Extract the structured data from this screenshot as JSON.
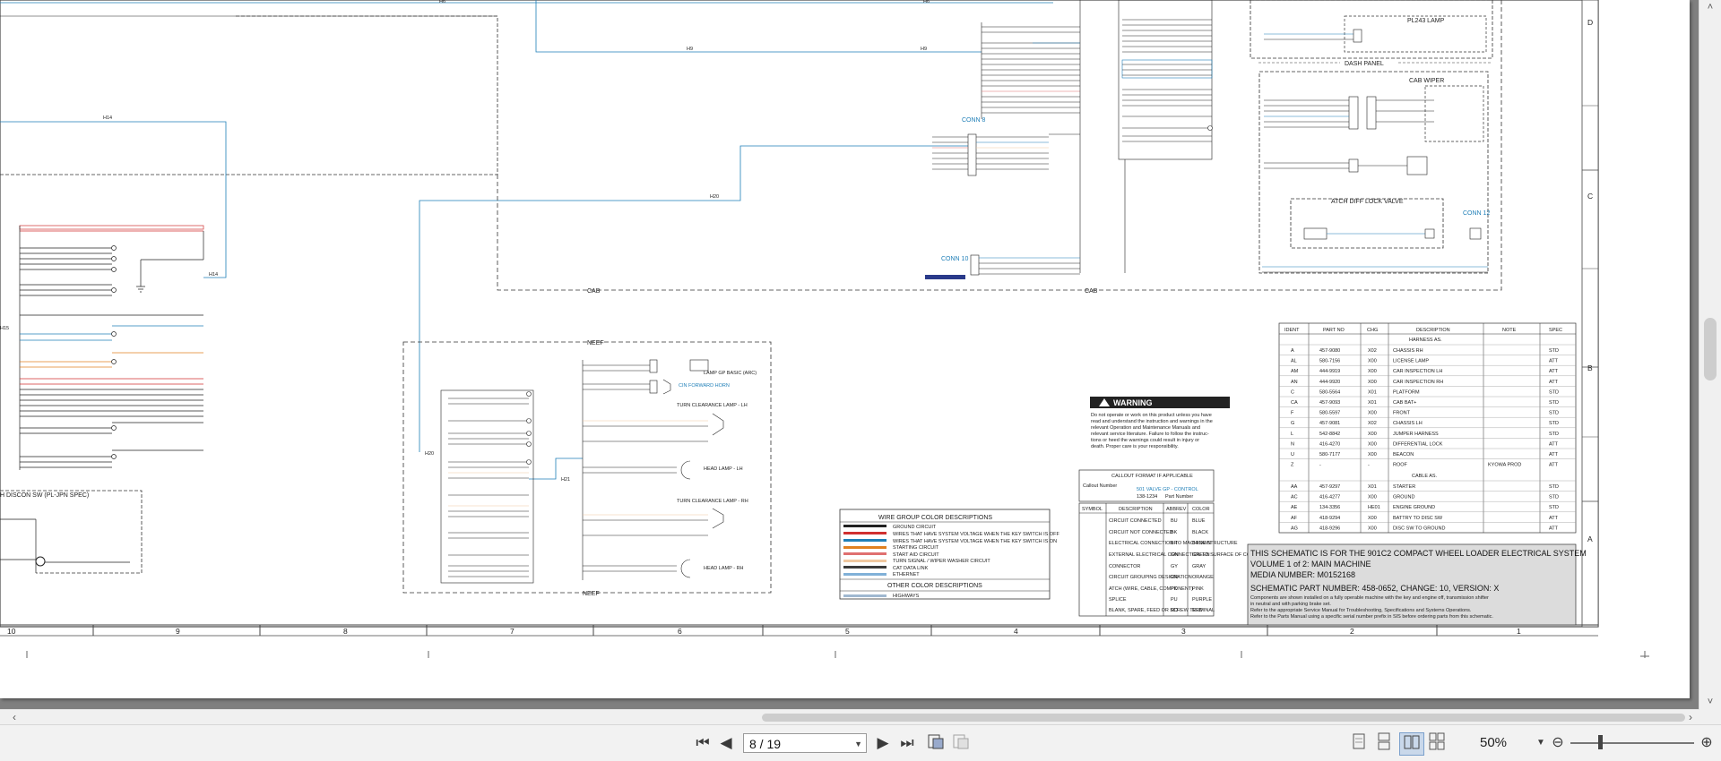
{
  "toolbar": {
    "first_page": "⏮",
    "prev_page": "◀",
    "page_field": "8 / 19",
    "next_page": "▶",
    "last_page": "⏭",
    "zoom": "50%"
  },
  "schematic": {
    "title_block": {
      "line1": "THIS SCHEMATIC IS FOR THE  901C2 COMPACT WHEEL LOADER ELECTRICAL SYSTEM",
      "line2": "VOLUME 1 of 2: MAIN MACHINE",
      "line3": "MEDIA NUMBER: M0152168",
      "line4": "SCHEMATIC PART NUMBER: 458-0652, CHANGE: 10, VERSION: X",
      "note1": "Components are shown installed on a fully operable machine with the key and engine off, transmission shifter",
      "note2": "in neutral and with parking brake set.",
      "note3": "Refer to the appropriate Service Manual for Troubleshooting, Specifications and Systems Operations.",
      "note4": "Refer to the Parts Manual using a specific serial number prefix in SIS before ordering parts from this schematic."
    },
    "warning": {
      "title": "WARNING",
      "text": [
        "Do not operate or work on this product unless you have",
        "read and understand the instruction and warnings in the",
        "relevant Operation and Maintenance Manuals and",
        "relevant service literature. Failure to follow the instruc-",
        "tions or heed the warnings could result in injury or",
        "death. Proper care is your responsibility."
      ]
    },
    "harness_table": {
      "headers": [
        "IDENT",
        "PART NO",
        "CHG",
        "DESCRIPTION",
        "NOTE",
        "SPEC"
      ],
      "section1": "HARNESS AS.",
      "rows1": [
        [
          "A",
          "457-9080",
          "X02",
          "CHASSIS RH",
          "",
          "STD"
        ],
        [
          "AL",
          "580-7156",
          "X00",
          "LICENSE LAMP",
          "",
          "ATT"
        ],
        [
          "AM",
          "444-9919",
          "X00",
          "CAR INSPECTION LH",
          "",
          "ATT"
        ],
        [
          "AN",
          "444-9920",
          "X00",
          "CAR INSPECTION RH",
          "",
          "ATT"
        ],
        [
          "C",
          "580-5564",
          "X01",
          "PLATFORM",
          "",
          "STD"
        ],
        [
          "CA",
          "457-9093",
          "X01",
          "CAB BAT+",
          "",
          "STD"
        ],
        [
          "F",
          "580-5597",
          "X00",
          "FRONT",
          "",
          "STD"
        ],
        [
          "G",
          "457-9081",
          "X02",
          "CHASSIS LH",
          "",
          "STD"
        ],
        [
          "L",
          "542-8842",
          "X00",
          "JUMPER HARNESS",
          "",
          "STD"
        ],
        [
          "N",
          "416-4270",
          "X00",
          "DIFFERENTIAL LOCK",
          "",
          "ATT"
        ],
        [
          "U",
          "580-7177",
          "X00",
          "BEACON",
          "",
          "ATT"
        ],
        [
          "Z",
          "-",
          "-",
          "ROOF",
          "KYOWA PROD",
          "ATT"
        ]
      ],
      "section2": "CABLE AS.",
      "rows2": [
        [
          "AA",
          "457-9297",
          "X01",
          "STARTER",
          "",
          "STD"
        ],
        [
          "AC",
          "416-4277",
          "X00",
          "GROUND",
          "",
          "STD"
        ],
        [
          "AE",
          "134-3356",
          "HE01",
          "ENGINE GROUND",
          "",
          "STD"
        ],
        [
          "AF",
          "418-9294",
          "X00",
          "BATTRY TO DISC SW",
          "",
          "ATT"
        ],
        [
          "AG",
          "418-9296",
          "X00",
          "DISC SW TO GROUND",
          "",
          "ATT"
        ]
      ]
    },
    "wire_colors": {
      "title": "WIRE GROUP COLOR DESCRIPTIONS",
      "items": [
        {
          "label": "GROUND CIRCUIT",
          "color": "#222222"
        },
        {
          "label": "WIRES THAT HAVE SYSTEM VOLTAGE WHEN THE KEY SWITCH IS OFF",
          "color": "#d03030"
        },
        {
          "label": "WIRES THAT HAVE SYSTEM VOLTAGE WHEN THE KEY SWITCH IS ON",
          "color": "#1f7fb8"
        },
        {
          "label": "STARTING CIRCUIT",
          "color": "#e08020"
        },
        {
          "label": "START AID CIRCUIT",
          "color": "#e07070"
        },
        {
          "label": "TURN SIGNAL / WIPER WASHER CIRCUIT",
          "color": "#f0c8a0"
        },
        {
          "label": "CAT DATA LINK",
          "color": "#3a3a3a"
        },
        {
          "label": "ETHERNET",
          "color": "#80b0d8"
        }
      ],
      "other_title": "OTHER COLOR DESCRIPTIONS",
      "other_items": [
        {
          "label": "HIGHWAYS",
          "color": "#a0b8d0"
        }
      ]
    },
    "callout": {
      "title": "CALLOUT FORMAT IF APPLICABLE",
      "callout_number": "Callout Number",
      "component_label": "501 VALVE GP - CONTROL",
      "part_number": "138-1234",
      "part_label": "Part Number",
      "headers": [
        "SYMBOL",
        "DESCRIPTION",
        "ABBREV",
        "COLOR"
      ],
      "rows": [
        [
          "CIRCUIT CONNECTED",
          "BU",
          "BLUE"
        ],
        [
          "CIRCUIT NOT CONNECTED",
          "BK",
          "BLACK"
        ],
        [
          "ELECTRICAL CONNECTION TO MACHINE STRUCTURE",
          "BR",
          "BROWN"
        ],
        [
          "EXTERNAL ELECTRICAL CONNECTION TO SURFACE OF COMPONENT",
          "GN",
          "GREEN"
        ],
        [
          "CONNECTOR",
          "GY",
          "GRAY"
        ],
        [
          "CIRCUIT GROUPING DESIGNATION",
          "OR",
          "ORANGE"
        ],
        [
          "ATCH (WIRE, CABLE, COMPONENT)",
          "PK",
          "PINK"
        ],
        [
          "SPLICE",
          "PU",
          "PURPLE"
        ],
        [
          "BLANK, SPARE, FEED OR SCREW TERMINAL",
          "RD",
          "RED"
        ]
      ],
      "color_col": [
        "RED",
        "WHITE",
        "ORANGE",
        "YELLOW",
        "PINK",
        "BLACK",
        "GRAY",
        "PURPLE",
        "BROWN",
        "GREEN",
        "BLUE"
      ]
    },
    "zones": [
      "10",
      "9",
      "8",
      "7",
      "6",
      "5",
      "4",
      "3",
      "2",
      "1"
    ],
    "rows_right": [
      "D",
      "C",
      "B",
      "A"
    ],
    "labels": {
      "cab_left": "CAB",
      "cab_right": "CAB",
      "neef_top": "NEEF",
      "neef_bottom": "NEEF",
      "dash_panel": "DASH PANEL",
      "pl243": "PL243 LAMP",
      "cab_wiper": "CAB WIPER",
      "atch_diff": "ATCH DIFF LOCK VALVE",
      "conn8": "CONN 8",
      "conn10": "CONN 10",
      "conn12": "CONN 12",
      "disc": "H DISCON SW (PL-JPN SPEC)",
      "h6": "H6",
      "h6b": "H6",
      "h9": "H9",
      "h9b": "H9",
      "h14": "H14",
      "h14b": "H14",
      "h20": "H20",
      "h20b": "H20",
      "h21": "H21",
      "h15": "H15",
      "turn_lh": "TURN CLEARANCE LAMP - LH",
      "turn_rh": "TURN CLEARANCE LAMP - RH",
      "head_lh": "HEAD LAMP - LH",
      "head_rh": "HEAD LAMP - RH",
      "fwd_horn": "CIN FORWARD HORN",
      "lamp_gp": "LAMP GP BASIC (ARC)"
    }
  }
}
